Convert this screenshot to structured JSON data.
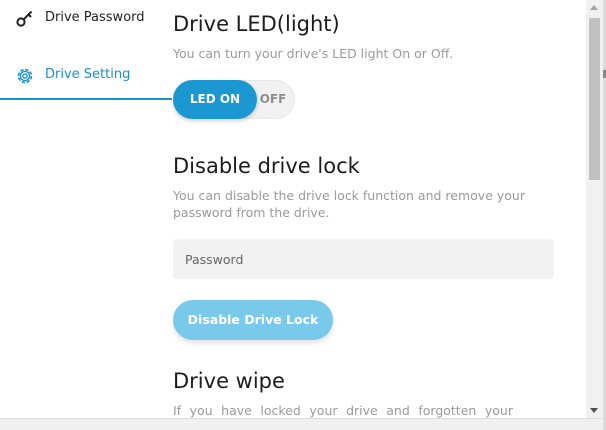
{
  "sidebar": {
    "items": [
      {
        "label": "Drive Password",
        "icon": "key-icon"
      },
      {
        "label": "Drive Setting",
        "icon": "gear-icon"
      }
    ],
    "accent_color": "#1a8fc9"
  },
  "led_section": {
    "title": "Drive LED(light)",
    "description": "You can turn your drive's LED light On or Off.",
    "toggle": {
      "on_label": "LED ON",
      "off_label": "OFF",
      "state": "on"
    }
  },
  "lock_section": {
    "title": "Disable drive lock",
    "description": "You can disable the drive lock function and remove your password from the drive.",
    "password_placeholder": "Password",
    "password_value": "",
    "button_label": "Disable Drive Lock"
  },
  "wipe_section": {
    "title": "Drive wipe",
    "description": "If you have locked your drive and forgotten your"
  },
  "colors": {
    "accent": "#1b97d2",
    "button_disabled": "#79c9ea"
  }
}
